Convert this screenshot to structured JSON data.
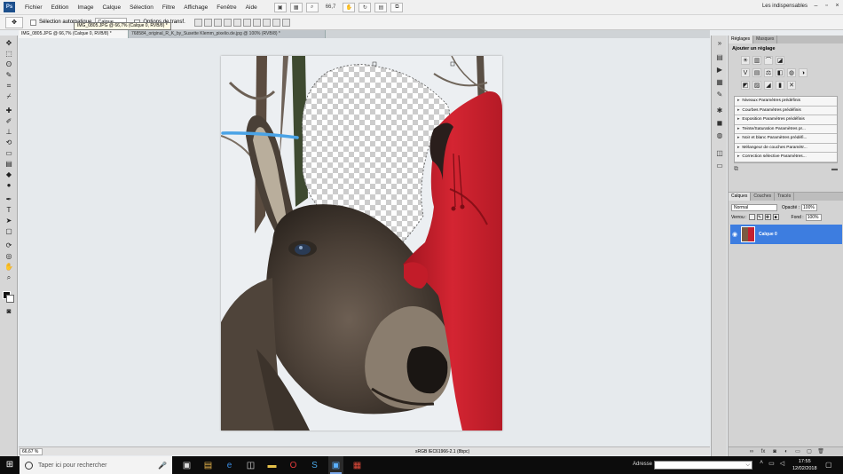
{
  "app": {
    "logo": "Ps",
    "menu": [
      "Fichier",
      "Edition",
      "Image",
      "Calque",
      "Sélection",
      "Filtre",
      "Affichage",
      "Fenêtre",
      "Aide"
    ],
    "zoom_menu": "66,7",
    "workspace": "Les indispensables"
  },
  "options": {
    "auto_select_label": "Sélection automatique",
    "auto_select_value": "Calque",
    "transform_label": "Options de transf."
  },
  "tabs": [
    {
      "label": "IMG_0805.JPG @ 66,7% (Calque 0, RVB/8) *",
      "active": true
    },
    {
      "label": "768584_original_R_K_by_Susette Klemm_pixelio.de.jpg @ 100% (RVB/8) *",
      "active": false
    }
  ],
  "tooltip": "IMG_0805.JPG @ 66,7% (Calque 0, RVB/8) *",
  "status": {
    "zoom": "66,67 %",
    "doc_profile": "sRGB IEC61966-2.1 (8bpc)"
  },
  "adjustments": {
    "tabs": [
      "Réglages",
      "Masques"
    ],
    "title": "Ajouter un réglage",
    "presets": [
      "Niveaux Paramètres prédéfinis",
      "Courbes Paramètres prédéfinis",
      "Exposition Paramètres prédéfinis",
      "Teinte/Saturation Paramètres pr...",
      "Noir et blanc Paramètres prédéfi...",
      "Mélangeur de couches Paramètr...",
      "Correction sélective Paramètres..."
    ]
  },
  "layers": {
    "tabs": [
      "Calques",
      "Couches",
      "Tracés"
    ],
    "blend_mode": "Normal",
    "opacity_label": "Opacité :",
    "opacity": "100%",
    "lock_label": "Verrou :",
    "fill_label": "Fond :",
    "fill": "100%",
    "layer_name": "Calque 0"
  },
  "taskbar": {
    "search_placeholder": "Taper ici pour rechercher",
    "address_label": "Adresse",
    "time": "17:55",
    "date": "12/02/2018"
  },
  "colors": {
    "accent": "#3d7de0",
    "taskbar": "#0c0c0c",
    "jacket_red": "#c42030"
  },
  "icons": [
    "photoshop-logo",
    "move-tool-icon",
    "search-icon",
    "mic-icon",
    "windows-start-icon"
  ]
}
